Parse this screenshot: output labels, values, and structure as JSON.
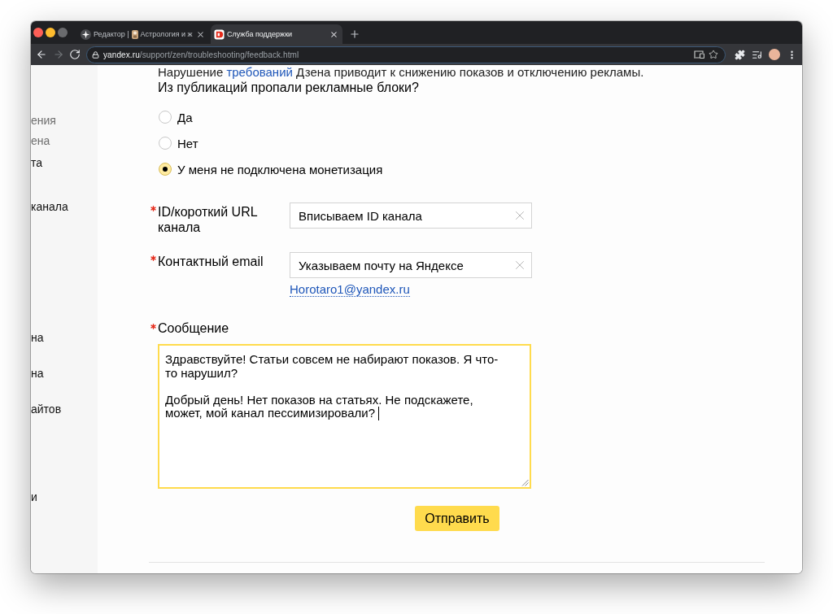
{
  "browser": {
    "tabs": [
      {
        "title": "Редактор |",
        "title_after_icon": "Астрология и ж",
        "selected": false
      },
      {
        "title": "Служба поддержки",
        "selected": true
      }
    ],
    "nav_buttons": [
      {
        "kind": "back",
        "disabled": false
      },
      {
        "kind": "forward",
        "disabled": true
      },
      {
        "kind": "reload",
        "disabled": false
      }
    ],
    "address": {
      "host": "yandex.ru",
      "path": "/support/zen/troubleshooting/feedback.html"
    }
  },
  "sidebar": {
    "items": [
      {
        "label": "ения",
        "kind": "sub"
      },
      {
        "label": "ена",
        "kind": "sub"
      },
      {
        "label": "та",
        "kind": "main"
      },
      {
        "label": "канала",
        "kind": "main"
      },
      {
        "label": "на",
        "kind": "main"
      },
      {
        "label": "на",
        "kind": "main"
      },
      {
        "label": "айтов",
        "kind": "main"
      },
      {
        "label": "и",
        "kind": "main"
      }
    ]
  },
  "form": {
    "notice": {
      "text_before": "Нарушение ",
      "link": "требований",
      "text_after": " Дзена приводит к снижению показов и отключению рекламы."
    },
    "question": "Из публикаций пропали рекламные блоки?",
    "options": [
      {
        "label": "Да",
        "selected": false
      },
      {
        "label": "Нет",
        "selected": false
      },
      {
        "label": "У меня не подключена монетизация",
        "selected": true
      }
    ],
    "fields": [
      {
        "label": "ID/короткий URL канала",
        "required": true,
        "value": "Вписываем ID канала"
      },
      {
        "label": "Контактный email",
        "required": true,
        "value": "Указываем почту на Яндексе",
        "suggestion": "Horotaro1@yandex.ru"
      }
    ],
    "message": {
      "label": "Сообщение",
      "required": true,
      "focused": true,
      "value": "Здравствуйте! Статьи совсем не набирают показов. Я что-то нарушил?\n\nДобрый день! Нет показов на статьях. Не подскажете, может, мой канал пессимизировали?"
    },
    "submit": "Отправить"
  }
}
